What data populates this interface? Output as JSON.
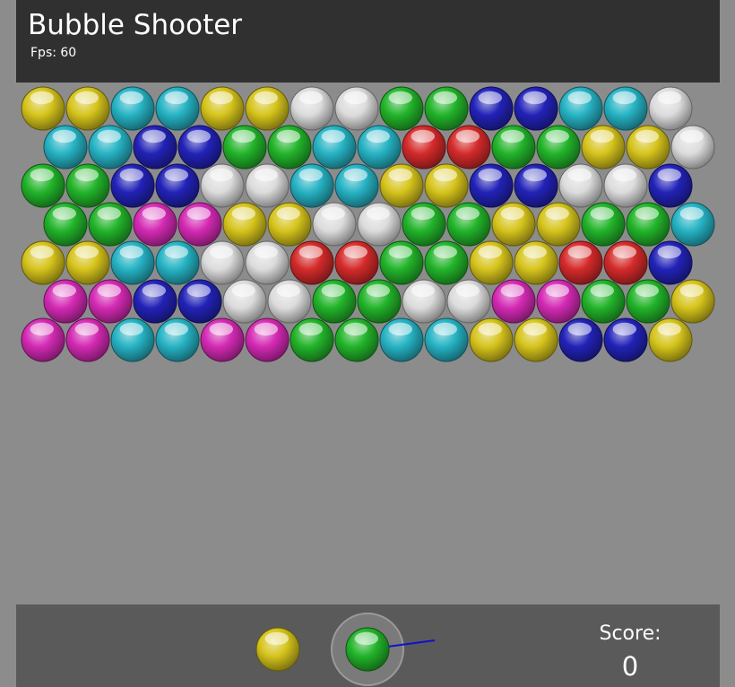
{
  "game": {
    "title": "Bubble Shooter",
    "fps_text": "Fps: 60"
  },
  "colors": {
    "yellow": "#d6c41c",
    "cyan": "#26b3c4",
    "white": "#dcdcdc",
    "green": "#22b42a",
    "blue": "#2222b8",
    "red": "#d42a2a",
    "magenta": "#d42ab4"
  },
  "grid": {
    "rows": [
      [
        "yellow",
        "yellow",
        "cyan",
        "cyan",
        "yellow",
        "yellow",
        "white",
        "white",
        "green",
        "green",
        "blue",
        "blue",
        "cyan",
        "cyan",
        "white"
      ],
      [
        "cyan",
        "cyan",
        "blue",
        "blue",
        "green",
        "green",
        "cyan",
        "cyan",
        "red",
        "red",
        "green",
        "green",
        "yellow",
        "yellow",
        "white"
      ],
      [
        "green",
        "green",
        "blue",
        "blue",
        "white",
        "white",
        "cyan",
        "cyan",
        "yellow",
        "yellow",
        "blue",
        "blue",
        "white",
        "white",
        "blue"
      ],
      [
        "green",
        "green",
        "magenta",
        "magenta",
        "yellow",
        "yellow",
        "white",
        "white",
        "green",
        "green",
        "yellow",
        "yellow",
        "green",
        "green",
        "cyan"
      ],
      [
        "yellow",
        "yellow",
        "cyan",
        "cyan",
        "white",
        "white",
        "red",
        "red",
        "green",
        "green",
        "yellow",
        "yellow",
        "red",
        "red",
        "blue"
      ],
      [
        "magenta",
        "magenta",
        "blue",
        "blue",
        "white",
        "white",
        "green",
        "green",
        "white",
        "white",
        "magenta",
        "magenta",
        "green",
        "green",
        "yellow"
      ],
      [
        "magenta",
        "magenta",
        "cyan",
        "cyan",
        "magenta",
        "magenta",
        "green",
        "green",
        "cyan",
        "cyan",
        "yellow",
        "yellow",
        "blue",
        "blue",
        "yellow"
      ]
    ]
  },
  "shooter": {
    "current_bubble": "green",
    "next_bubble": "yellow",
    "aim_line_color": "#1010cc"
  },
  "score": {
    "label": "Score:",
    "value": "0"
  }
}
